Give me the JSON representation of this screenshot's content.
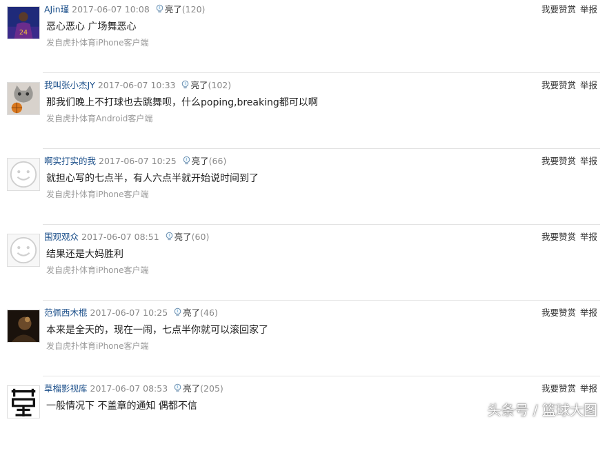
{
  "actions": {
    "reward_label": "我要赞赏",
    "report_label": "举报"
  },
  "light_label": "亮了",
  "comments": [
    {
      "user": "AJin瑾",
      "time": "2017-06-07 10:08",
      "count": "(120)",
      "text": "恶心恶心 广场舞恶心",
      "device": "发自虎扑体育iPhone客户端",
      "avatar": "player-photo"
    },
    {
      "user": "我叫张小杰JY",
      "time": "2017-06-07 10:33",
      "count": "(102)",
      "text": "那我们晚上不打球也去跳舞呗，什么poping,breaking都可以啊",
      "device": "发自虎扑体育Android客户端",
      "avatar": "cat-basketball"
    },
    {
      "user": "啊实打实的我",
      "time": "2017-06-07 10:25",
      "count": "(66)",
      "text": "就担心写的七点半，有人六点半就开始说时间到了",
      "device": "发自虎扑体育iPhone客户端",
      "avatar": "default-smiley"
    },
    {
      "user": "围观观众",
      "time": "2017-06-07 08:51",
      "count": "(60)",
      "text": "结果还是大妈胜利",
      "device": "发自虎扑体育iPhone客户端",
      "avatar": "default-smiley"
    },
    {
      "user": "范佩西木棍",
      "time": "2017-06-07 10:25",
      "count": "(46)",
      "text": "本来是全天的，现在一闹，七点半你就可以滚回家了",
      "device": "发自虎扑体育iPhone客户端",
      "avatar": "dark-photo"
    },
    {
      "user": "草榴影视库",
      "time": "2017-06-07 08:53",
      "count": "(205)",
      "text": "一般情况下 不盖章的通知 偶都不信",
      "device": "",
      "avatar": "calligraphy"
    }
  ],
  "watermark": "头条号 / 篮球大图"
}
